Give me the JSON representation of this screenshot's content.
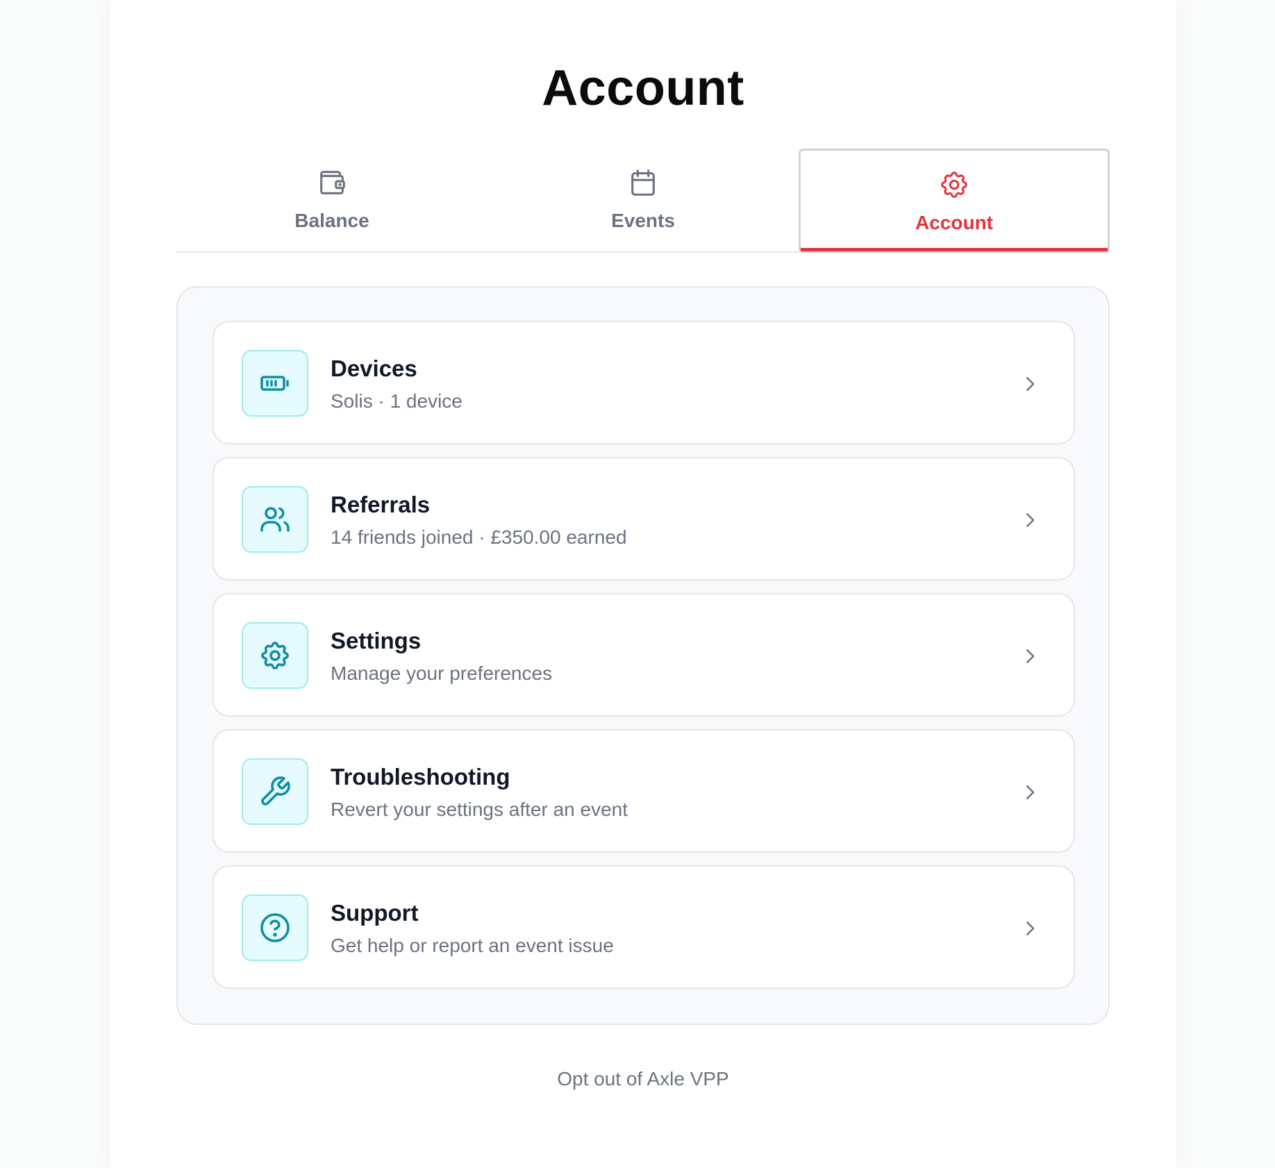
{
  "page_title": "Account",
  "tabs": [
    {
      "label": "Balance",
      "icon": "wallet-icon",
      "active": false
    },
    {
      "label": "Events",
      "icon": "calendar-icon",
      "active": false
    },
    {
      "label": "Account",
      "icon": "gear-icon",
      "active": true
    }
  ],
  "items": [
    {
      "title": "Devices",
      "subtitle": "Solis · 1 device",
      "icon": "battery-icon"
    },
    {
      "title": "Referrals",
      "subtitle": "14 friends joined · £350.00 earned",
      "icon": "users-icon"
    },
    {
      "title": "Settings",
      "subtitle": "Manage your preferences",
      "icon": "gear-icon"
    },
    {
      "title": "Troubleshooting",
      "subtitle": "Revert your settings after an event",
      "icon": "wrench-icon"
    },
    {
      "title": "Support",
      "subtitle": "Get help or report an event issue",
      "icon": "help-circle-icon"
    }
  ],
  "opt_out_label": "Opt out of Axle VPP",
  "colors": {
    "accent": "#e5333f",
    "icon_teal": "#0e8fa8",
    "icon_bg": "#e5fbfd",
    "tab_inactive": "#6b7280"
  }
}
